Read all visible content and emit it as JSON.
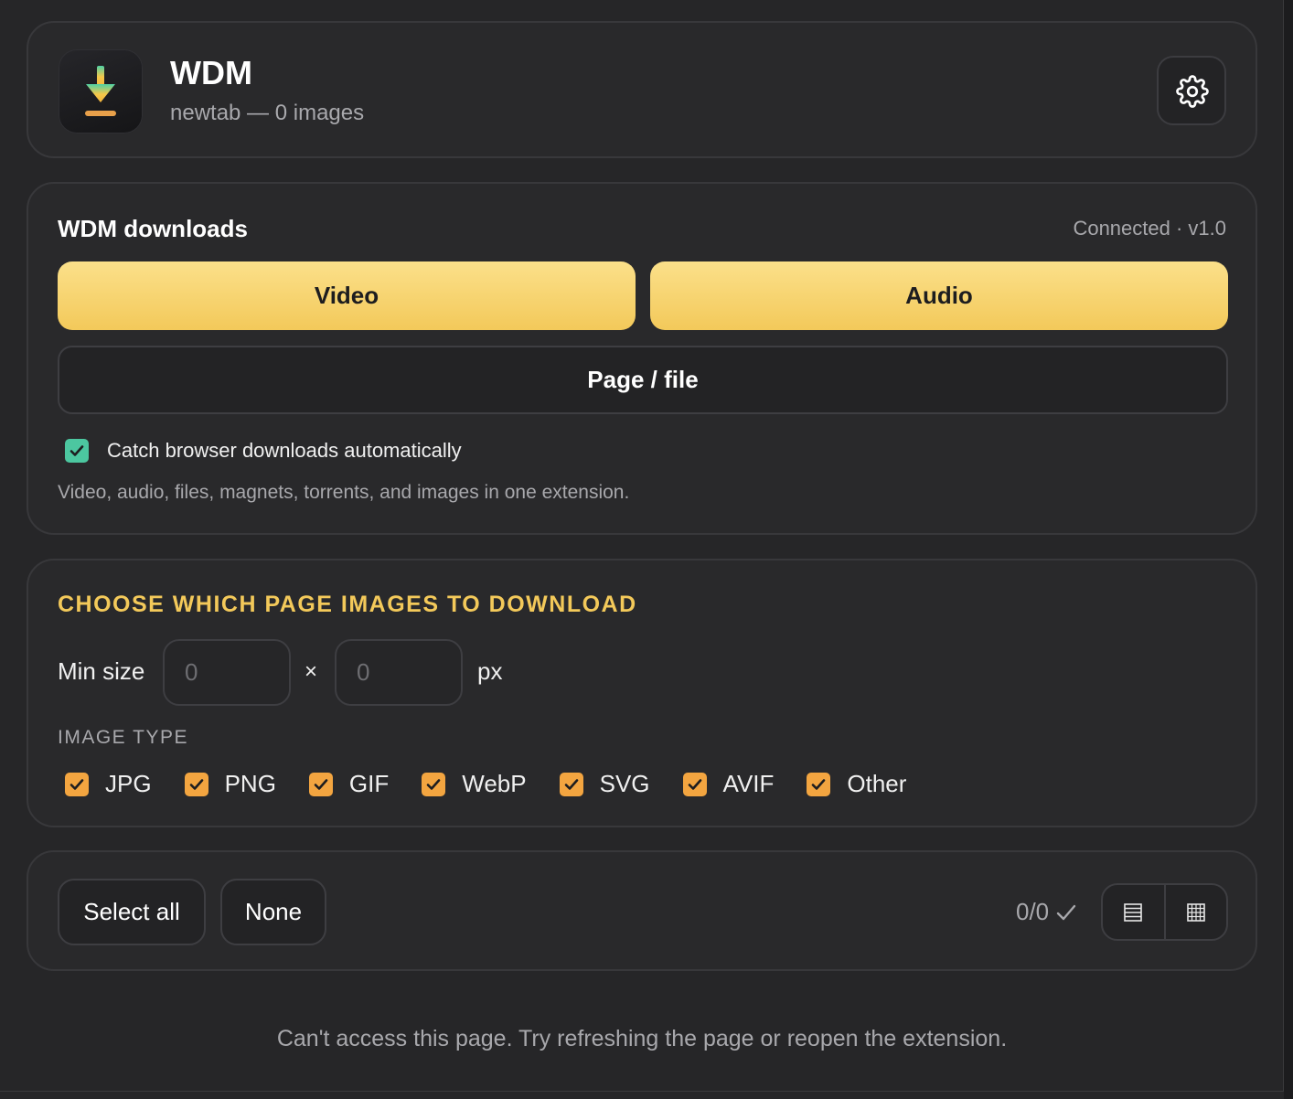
{
  "header": {
    "title": "WDM",
    "subtitle": "newtab — 0 images",
    "settings_icon": "gear-icon"
  },
  "downloads": {
    "title": "WDM downloads",
    "status": "Connected · v1.0",
    "video_label": "Video",
    "audio_label": "Audio",
    "page_file_label": "Page / file",
    "catch_label": "Catch browser downloads automatically",
    "catch_checked": true,
    "description": "Video, audio, files, magnets, torrents, and images in one extension."
  },
  "images": {
    "title": "CHOOSE WHICH PAGE IMAGES TO DOWNLOAD",
    "min_size_label": "Min size",
    "width_placeholder": "0",
    "height_placeholder": "0",
    "times": "×",
    "unit": "px",
    "type_label": "IMAGE TYPE",
    "types": [
      {
        "label": "JPG",
        "checked": true
      },
      {
        "label": "PNG",
        "checked": true
      },
      {
        "label": "GIF",
        "checked": true
      },
      {
        "label": "WebP",
        "checked": true
      },
      {
        "label": "SVG",
        "checked": true
      },
      {
        "label": "AVIF",
        "checked": true
      },
      {
        "label": "Other",
        "checked": true
      }
    ]
  },
  "actions": {
    "select_all_label": "Select all",
    "none_label": "None",
    "count": "0/0",
    "list_view_icon": "list-view-icon",
    "grid_view_icon": "grid-view-icon"
  },
  "footer": {
    "message": "Can't access this page. Try refreshing the page or reopen the extension."
  },
  "colors": {
    "accent_yellow": "#f3c95a",
    "check_green": "#4cc7a0",
    "check_orange": "#f3a540",
    "background": "#262628"
  }
}
